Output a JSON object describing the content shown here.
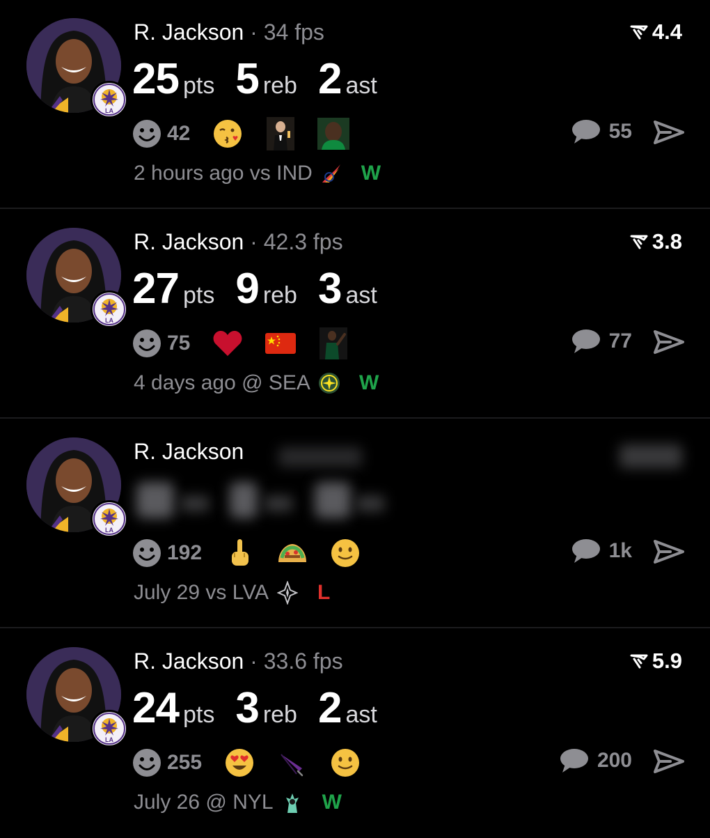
{
  "posts": [
    {
      "player": "R. Jackson",
      "fps": "34 fps",
      "rating": "4.4",
      "stats": [
        {
          "value": "25",
          "label": "pts"
        },
        {
          "value": "5",
          "label": "reb"
        },
        {
          "value": "2",
          "label": "ast"
        }
      ],
      "reaction_count": "42",
      "reaction_emojis": [
        "kissing-face-emoji",
        "toast-gif-emoji",
        "player-face-emoji"
      ],
      "comment_count": "55",
      "time": "2 hours ago",
      "matchup": "vs IND",
      "opponent_logo": "fever-logo",
      "result": "W",
      "result_color": "#1fa34a"
    },
    {
      "player": "R. Jackson",
      "fps": "42.3 fps",
      "rating": "3.8",
      "stats": [
        {
          "value": "27",
          "label": "pts"
        },
        {
          "value": "9",
          "label": "reb"
        },
        {
          "value": "3",
          "label": "ast"
        }
      ],
      "reaction_count": "75",
      "reaction_emojis": [
        "heart-emoji",
        "china-flag-emoji",
        "player-gesture-emoji"
      ],
      "comment_count": "77",
      "time": "4 days ago",
      "matchup": "@ SEA",
      "opponent_logo": "storm-logo",
      "result": "W",
      "result_color": "#1fa34a"
    },
    {
      "player": "R. Jackson",
      "fps": "",
      "rating": "",
      "stats": [
        {
          "value": "",
          "label": ""
        },
        {
          "value": "",
          "label": ""
        },
        {
          "value": "",
          "label": ""
        }
      ],
      "reaction_count": "192",
      "reaction_emojis": [
        "middle-finger-emoji",
        "taco-emoji",
        "slight-smile-emoji"
      ],
      "comment_count": "1k",
      "time": "July 29",
      "matchup": "vs LVA",
      "opponent_logo": "aces-logo",
      "result": "L",
      "result_color": "#e0302c"
    },
    {
      "player": "R. Jackson",
      "fps": "33.6 fps",
      "rating": "5.9",
      "stats": [
        {
          "value": "24",
          "label": "pts"
        },
        {
          "value": "3",
          "label": "reb"
        },
        {
          "value": "2",
          "label": "ast"
        }
      ],
      "reaction_count": "255",
      "reaction_emojis": [
        "heart-eyes-emoji",
        "umbrella-emoji",
        "slight-smile-emoji"
      ],
      "comment_count": "200",
      "time": "July 26",
      "matchup": "@ NYL",
      "opponent_logo": "liberty-logo",
      "result": "W",
      "result_color": "#1fa34a"
    }
  ],
  "colors": {
    "background": "#000000",
    "muted_text": "#8e8e93",
    "win": "#1fa34a",
    "loss": "#e0302c",
    "avatar_bg": "#3a2c58"
  }
}
